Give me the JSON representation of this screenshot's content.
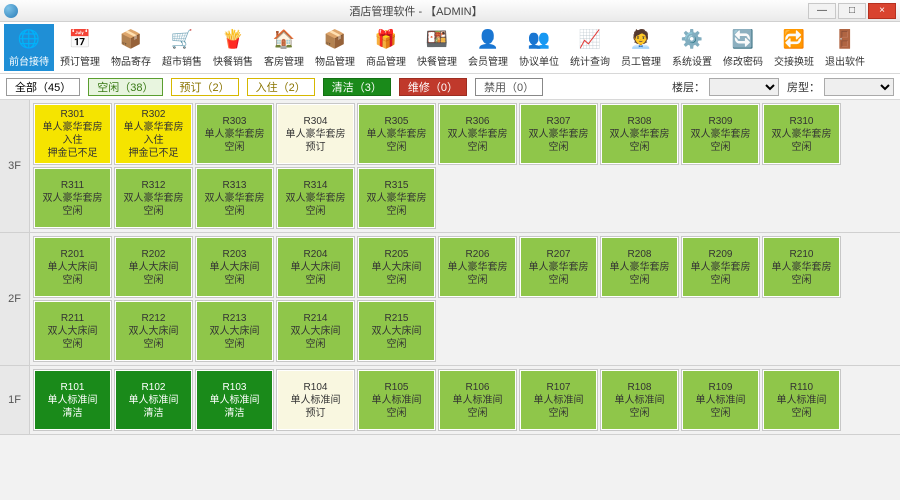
{
  "window": {
    "title": "酒店管理软件 - 【ADMIN】",
    "min": "—",
    "max": "□",
    "close": "×"
  },
  "toolbar": [
    {
      "icon": "🌐",
      "label": "前台接待",
      "active": true
    },
    {
      "icon": "📅",
      "label": "预订管理"
    },
    {
      "icon": "📦",
      "label": "物品寄存"
    },
    {
      "icon": "🛒",
      "label": "超市销售"
    },
    {
      "icon": "🍟",
      "label": "快餐销售"
    },
    {
      "icon": "🏠",
      "label": "客房管理"
    },
    {
      "icon": "📦",
      "label": "物品管理"
    },
    {
      "icon": "🎁",
      "label": "商品管理"
    },
    {
      "icon": "🍱",
      "label": "快餐管理"
    },
    {
      "icon": "👤",
      "label": "会员管理"
    },
    {
      "icon": "👥",
      "label": "协议单位"
    },
    {
      "icon": "📈",
      "label": "统计查询"
    },
    {
      "icon": "🧑‍💼",
      "label": "员工管理"
    },
    {
      "icon": "⚙️",
      "label": "系统设置"
    },
    {
      "icon": "🔄",
      "label": "修改密码"
    },
    {
      "icon": "🔁",
      "label": "交接换班"
    },
    {
      "icon": "🚪",
      "label": "退出软件"
    }
  ],
  "filters": {
    "all": "全部（45）",
    "vacant": "空闲（38）",
    "reserved": "预订（2）",
    "occupied": "入住（2）",
    "cleaning": "清洁（3）",
    "maintenance": "维修（0）",
    "disabled": "禁用（0）",
    "floor_label": "楼层：",
    "type_label": "房型："
  },
  "floors": [
    {
      "label": "3F",
      "lines": [
        [
          {
            "num": "R301",
            "type": "单人豪华套房",
            "status": "入住",
            "extra": "押金已不足",
            "st": "occupied"
          },
          {
            "num": "R302",
            "type": "单人豪华套房",
            "status": "入住",
            "extra": "押金已不足",
            "st": "occupied"
          },
          {
            "num": "R303",
            "type": "单人豪华套房",
            "status": "空闲",
            "st": "vacant"
          },
          {
            "num": "R304",
            "type": "单人豪华套房",
            "status": "预订",
            "st": "reserved"
          },
          {
            "num": "R305",
            "type": "单人豪华套房",
            "status": "空闲",
            "st": "vacant"
          },
          {
            "num": "R306",
            "type": "双人豪华套房",
            "status": "空闲",
            "st": "vacant"
          },
          {
            "num": "R307",
            "type": "双人豪华套房",
            "status": "空闲",
            "st": "vacant"
          },
          {
            "num": "R308",
            "type": "双人豪华套房",
            "status": "空闲",
            "st": "vacant"
          },
          {
            "num": "R309",
            "type": "双人豪华套房",
            "status": "空闲",
            "st": "vacant"
          },
          {
            "num": "R310",
            "type": "双人豪华套房",
            "status": "空闲",
            "st": "vacant"
          }
        ],
        [
          {
            "num": "R311",
            "type": "双人豪华套房",
            "status": "空闲",
            "st": "vacant"
          },
          {
            "num": "R312",
            "type": "双人豪华套房",
            "status": "空闲",
            "st": "vacant"
          },
          {
            "num": "R313",
            "type": "双人豪华套房",
            "status": "空闲",
            "st": "vacant"
          },
          {
            "num": "R314",
            "type": "双人豪华套房",
            "status": "空闲",
            "st": "vacant"
          },
          {
            "num": "R315",
            "type": "双人豪华套房",
            "status": "空闲",
            "st": "vacant"
          }
        ]
      ]
    },
    {
      "label": "2F",
      "lines": [
        [
          {
            "num": "R201",
            "type": "单人大床间",
            "status": "空闲",
            "st": "vacant"
          },
          {
            "num": "R202",
            "type": "单人大床间",
            "status": "空闲",
            "st": "vacant"
          },
          {
            "num": "R203",
            "type": "单人大床间",
            "status": "空闲",
            "st": "vacant"
          },
          {
            "num": "R204",
            "type": "单人大床间",
            "status": "空闲",
            "st": "vacant"
          },
          {
            "num": "R205",
            "type": "单人大床间",
            "status": "空闲",
            "st": "vacant"
          },
          {
            "num": "R206",
            "type": "单人豪华套房",
            "status": "空闲",
            "st": "vacant"
          },
          {
            "num": "R207",
            "type": "单人豪华套房",
            "status": "空闲",
            "st": "vacant"
          },
          {
            "num": "R208",
            "type": "单人豪华套房",
            "status": "空闲",
            "st": "vacant"
          },
          {
            "num": "R209",
            "type": "单人豪华套房",
            "status": "空闲",
            "st": "vacant"
          },
          {
            "num": "R210",
            "type": "单人豪华套房",
            "status": "空闲",
            "st": "vacant"
          }
        ],
        [
          {
            "num": "R211",
            "type": "双人大床间",
            "status": "空闲",
            "st": "vacant"
          },
          {
            "num": "R212",
            "type": "双人大床间",
            "status": "空闲",
            "st": "vacant"
          },
          {
            "num": "R213",
            "type": "双人大床间",
            "status": "空闲",
            "st": "vacant"
          },
          {
            "num": "R214",
            "type": "双人大床间",
            "status": "空闲",
            "st": "vacant"
          },
          {
            "num": "R215",
            "type": "双人大床间",
            "status": "空闲",
            "st": "vacant"
          }
        ]
      ]
    },
    {
      "label": "1F",
      "lines": [
        [
          {
            "num": "R101",
            "type": "单人标准间",
            "status": "清洁",
            "st": "cleaning"
          },
          {
            "num": "R102",
            "type": "单人标准间",
            "status": "清洁",
            "st": "cleaning"
          },
          {
            "num": "R103",
            "type": "单人标准间",
            "status": "清洁",
            "st": "cleaning"
          },
          {
            "num": "R104",
            "type": "单人标准间",
            "status": "预订",
            "st": "reserved"
          },
          {
            "num": "R105",
            "type": "单人标准间",
            "status": "空闲",
            "st": "vacant"
          },
          {
            "num": "R106",
            "type": "单人标准间",
            "status": "空闲",
            "st": "vacant"
          },
          {
            "num": "R107",
            "type": "单人标准间",
            "status": "空闲",
            "st": "vacant"
          },
          {
            "num": "R108",
            "type": "单人标准间",
            "status": "空闲",
            "st": "vacant"
          },
          {
            "num": "R109",
            "type": "单人标准间",
            "status": "空闲",
            "st": "vacant"
          },
          {
            "num": "R110",
            "type": "单人标准间",
            "status": "空闲",
            "st": "vacant"
          }
        ]
      ]
    }
  ]
}
